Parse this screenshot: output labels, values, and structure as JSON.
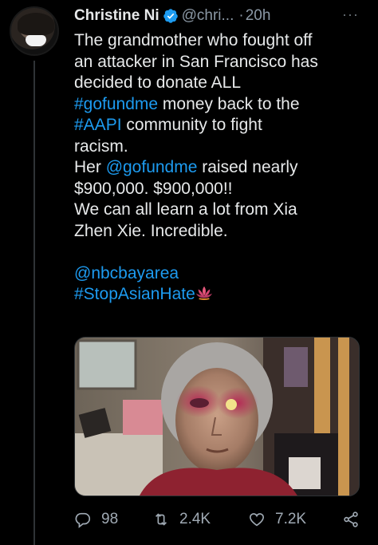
{
  "tweet": {
    "author_name": "Christine Ni",
    "handle": "@chri...",
    "separator": "·",
    "time": "20h",
    "more_label": "···",
    "lines": {
      "l1": "The grandmother who fought off",
      "l2": "an attacker in San Francisco has",
      "l3": "decided to donate ALL",
      "l4_link": "#gofundme",
      "l4_rest": " money back to the",
      "l5_link": "#AAPI",
      "l5_rest": " community to fight",
      "l6": "racism.",
      "l7_pre": "Her ",
      "l7_link": "@gofundme",
      "l7_rest": " raised nearly",
      "l8": "$900,000. $900,000!!",
      "l9": "We can all learn a lot from Xia",
      "l10": "Zhen Xie. Incredible.",
      "l12_link": "@nbcbayarea",
      "l13_link": "#StopAsianHate"
    },
    "counts": {
      "replies": "98",
      "retweets": "2.4K",
      "likes": "7.2K"
    }
  },
  "colors": {
    "background": "#000000",
    "text": "#e7e9ea",
    "secondary": "#8b98a5",
    "link": "#1d9bf0",
    "verified": "#1d9bf0"
  },
  "icons": {
    "verified": "verified-badge-icon",
    "emoji": "lotus-emoji-icon",
    "reply": "reply-icon",
    "retweet": "retweet-icon",
    "like": "heart-icon",
    "share": "share-icon"
  }
}
